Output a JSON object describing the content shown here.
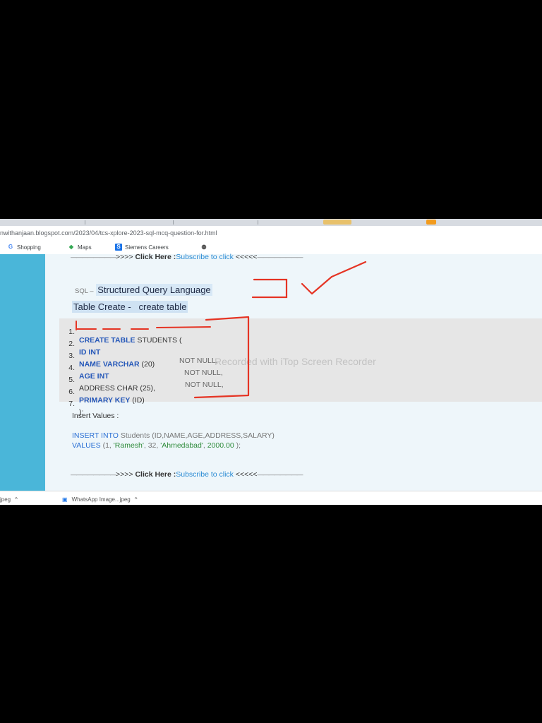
{
  "browser": {
    "url": "nwithanjaan.blogspot.com/2023/04/tcs-xplore-2023-sql-mcq-question-for.html",
    "bookmarks": [
      "Shopping",
      "Maps",
      "Siemens Careers"
    ]
  },
  "article": {
    "cta_arrows_left": ">>>>",
    "cta_click_here": "Click Here :",
    "cta_subscribe": "Subscribe to click",
    "cta_arrows_right": "<<<<<",
    "sql_prefix": "SQL –",
    "sql_title": "Structured Query Language",
    "table_create": "Table Create -   create table",
    "code_lines": [
      {
        "num": "1.",
        "kw": "CREATE TABLE",
        "rest": " STUDENTS (",
        "tail": ""
      },
      {
        "num": "2.",
        "kw": "ID INT",
        "rest": "",
        "tail": "NOT NULL,"
      },
      {
        "num": "3.",
        "kw": "NAME VARCHAR",
        "rest": " (20)",
        "tail": "NOT NULL,"
      },
      {
        "num": "4.",
        "kw": "AGE INT",
        "rest": "",
        "tail": "NOT NULL,"
      },
      {
        "num": "5.",
        "kw": "",
        "rest": "ADDRESS CHAR (25),",
        "tail": ""
      },
      {
        "num": "6.",
        "kw": "PRIMARY KEY",
        "rest": " (ID)",
        "tail": ""
      },
      {
        "num": "7.",
        "kw": "",
        "rest": ");",
        "tail": ""
      }
    ],
    "insert_label": "Insert Values :",
    "insert_kw": "INSERT INTO",
    "insert_rest": " Students (ID,NAME,AGE,ADDRESS,SALARY)",
    "values_kw": "VALUES",
    "values_open": " (1, ",
    "values_name": "'Ramesh'",
    "values_age": ", 32, ",
    "values_city": "'Ahmedabad'",
    "values_sep": ", ",
    "values_salary": "2000.00",
    "values_close": " );"
  },
  "watermark": "Recorded with iTop Screen Recorder",
  "downloads": [
    "jpeg",
    "WhatsApp Image...jpeg"
  ],
  "colors": {
    "sidebar": "#4ab6d9",
    "annotation": "#e53424",
    "link": "#2a8bd4"
  }
}
